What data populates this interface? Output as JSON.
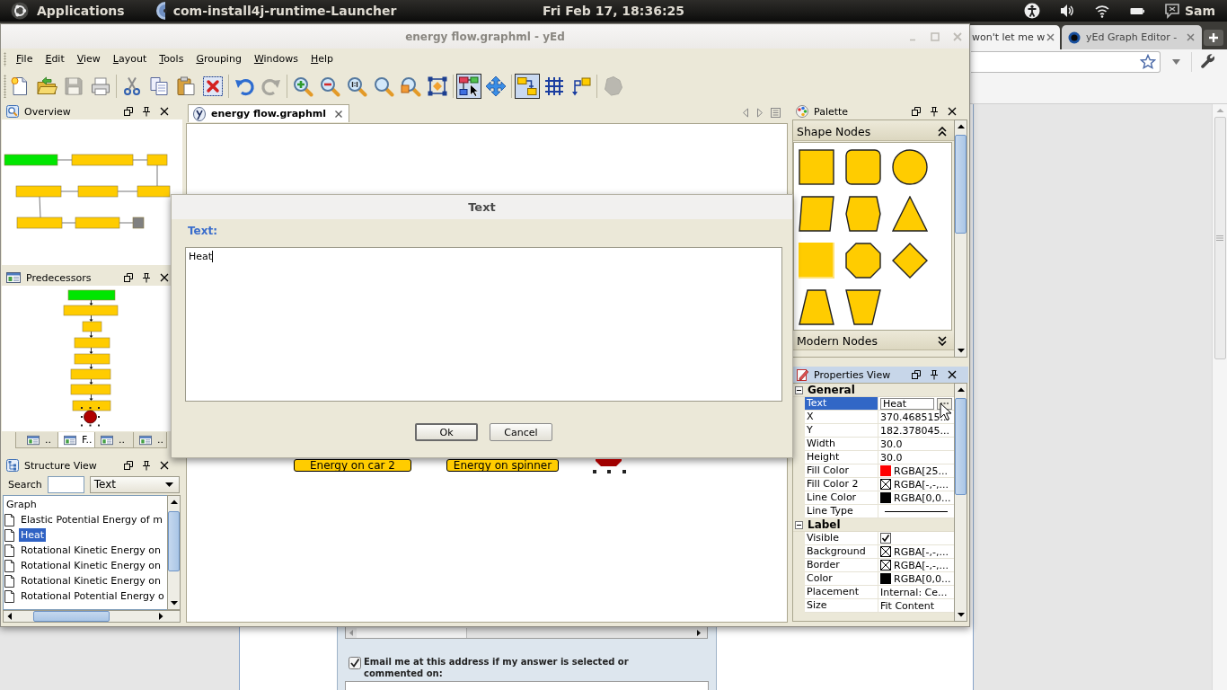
{
  "top_panel": {
    "menu": "Applications",
    "app_name": "com-install4j-runtime-Launcher",
    "clock": "Fri Feb 17, 18:36:25",
    "user": "Sam"
  },
  "browser": {
    "tabs": [
      {
        "title": "won't let me w",
        "selected": true
      },
      {
        "title": "yEd Graph Editor -",
        "selected": false
      }
    ],
    "email_option": {
      "label": "Email me at this address if my answer is selected or commented on:",
      "checked": true
    }
  },
  "window": {
    "title": "energy flow.graphml - yEd",
    "active": false
  },
  "menu": [
    "File",
    "Edit",
    "View",
    "Layout",
    "Tools",
    "Grouping",
    "Windows",
    "Help"
  ],
  "toolbar": [
    [
      {
        "pressed": false,
        "disabled": false
      },
      {
        "pressed": false,
        "disabled": false
      },
      {
        "pressed": false,
        "disabled": true
      },
      {
        "pressed": false,
        "disabled": false
      }
    ],
    [
      {
        "pressed": false,
        "disabled": false
      },
      {
        "pressed": false,
        "disabled": false
      },
      {
        "pressed": false,
        "disabled": false
      },
      {
        "pressed": false,
        "disabled": false
      }
    ],
    [
      {
        "pressed": false,
        "disabled": false
      },
      {
        "pressed": false,
        "disabled": true
      }
    ],
    [
      {
        "pressed": false,
        "disabled": false
      },
      {
        "pressed": false,
        "disabled": false
      },
      {
        "pressed": false,
        "disabled": false
      },
      {
        "pressed": false,
        "disabled": false
      },
      {
        "pressed": false,
        "disabled": false
      },
      {
        "pressed": false,
        "disabled": false
      }
    ],
    [
      {
        "pressed": true,
        "disabled": false
      },
      {
        "pressed": false,
        "disabled": false
      }
    ],
    [
      {
        "pressed": true,
        "disabled": false
      },
      {
        "pressed": false,
        "disabled": false
      },
      {
        "pressed": false,
        "disabled": false
      }
    ],
    [
      {
        "pressed": false,
        "disabled": true
      }
    ]
  ],
  "overview": {
    "title": "Overview"
  },
  "predecessors": {
    "title": "Predecessors",
    "tabs": [
      {
        "label": "..",
        "selected": false
      },
      {
        "label": "F..",
        "selected": true
      },
      {
        "label": "..",
        "selected": false
      },
      {
        "label": "..",
        "selected": false
      }
    ]
  },
  "structure_view": {
    "title": "Structure View",
    "search_label": "Search",
    "filter": "Text",
    "tree": {
      "label": "Graph",
      "children": [
        {
          "label": "Elastic Potential Energy of m",
          "selected": false
        },
        {
          "label": "Heat",
          "selected": true
        },
        {
          "label": "Rotational Kinetic Energy on",
          "selected": false
        },
        {
          "label": "Rotational Kinetic Energy on",
          "selected": false
        },
        {
          "label": "Rotational Kinetic Energy on",
          "selected": false
        },
        {
          "label": "Rotational Potential Energy o",
          "selected": false
        }
      ]
    }
  },
  "document_tabs": [
    {
      "title": "energy flow.graphml",
      "selected": true
    }
  ],
  "canvas": {
    "nodes": [
      {
        "kind": "rectangle",
        "label": "Energy on car 2",
        "color": "#ffcc00",
        "selected": false
      },
      {
        "kind": "rectangle",
        "label": "Energy on spinner",
        "color": "#ffcc00",
        "selected": false
      },
      {
        "kind": "octagon",
        "color": "#a00000",
        "selected": true
      }
    ]
  },
  "palette": {
    "title": "Palette",
    "sections": [
      {
        "title": "Shape Nodes",
        "expanded": true
      },
      {
        "title": "Modern Nodes",
        "expanded": false
      }
    ]
  },
  "properties": {
    "title": "Properties View",
    "sections": [
      {
        "title": "General",
        "expanded": true,
        "rows": [
          {
            "name": "Text",
            "kind": "edit",
            "value": "Heat",
            "selected": true
          },
          {
            "name": "X",
            "kind": "text",
            "value": "370.468515...",
            "selected": false
          },
          {
            "name": "Y",
            "kind": "text",
            "value": "182.378045...",
            "selected": false
          },
          {
            "name": "Width",
            "kind": "text",
            "value": "30.0",
            "selected": false
          },
          {
            "name": "Height",
            "kind": "text",
            "value": "30.0",
            "selected": false
          },
          {
            "name": "Fill Color",
            "kind": "color",
            "color": "#ff0000",
            "value": "RGBA[25...",
            "selected": false
          },
          {
            "name": "Fill Color 2",
            "kind": "no_color",
            "value": "RGBA[-,-,...",
            "selected": false
          },
          {
            "name": "Line Color",
            "kind": "color",
            "color": "#000000",
            "value": "RGBA[0,0...",
            "selected": false
          },
          {
            "name": "Line Type",
            "kind": "line",
            "selected": false
          }
        ]
      },
      {
        "title": "Label",
        "expanded": true,
        "rows": [
          {
            "name": "Visible",
            "kind": "check",
            "checked": true,
            "selected": false
          },
          {
            "name": "Background",
            "kind": "no_color",
            "value": "RGBA[-,-,...",
            "selected": false
          },
          {
            "name": "Border",
            "kind": "no_color",
            "value": "RGBA[-,-,...",
            "selected": false
          },
          {
            "name": "Color",
            "kind": "color",
            "color": "#000000",
            "value": "RGBA[0,0...",
            "selected": false
          },
          {
            "name": "Placement",
            "kind": "text",
            "value": "Internal: Ce...",
            "selected": false
          },
          {
            "name": "Size",
            "kind": "text",
            "value": "Fit Content",
            "selected": false
          }
        ]
      }
    ]
  },
  "dialog": {
    "title": "Text",
    "field_label": "Text:",
    "value": "Heat",
    "buttons": [
      {
        "label": "Ok",
        "default": true
      },
      {
        "label": "Cancel",
        "default": false
      }
    ]
  }
}
